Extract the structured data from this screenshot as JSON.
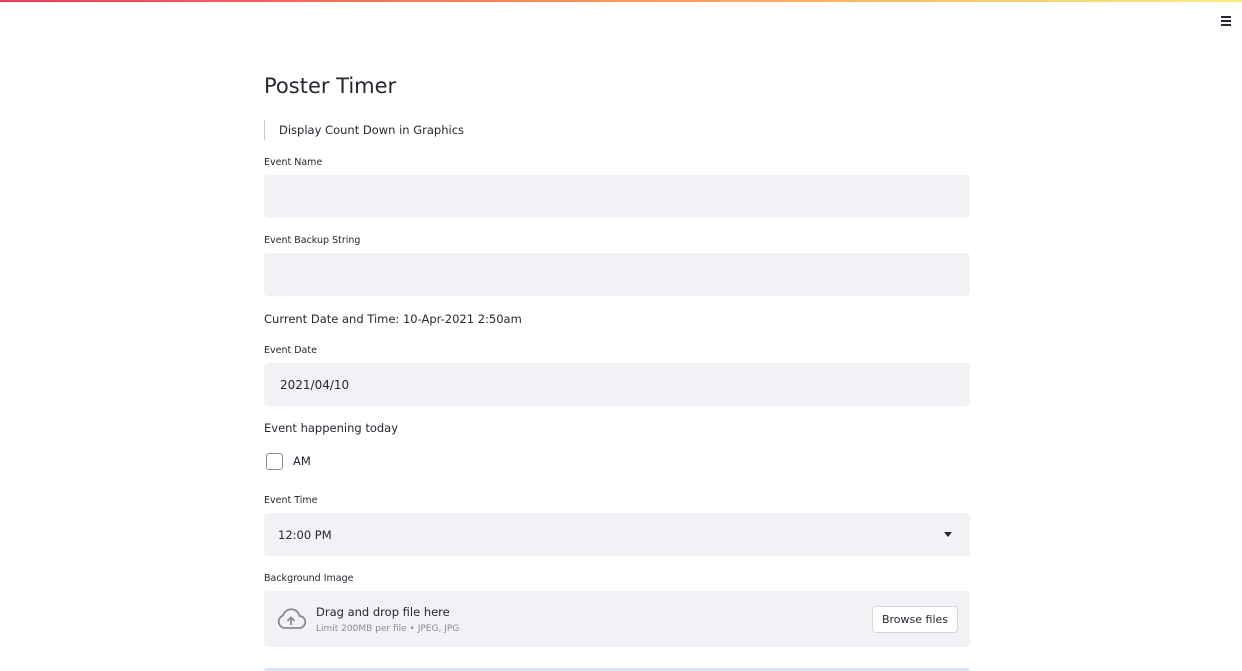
{
  "app": {
    "menu_icon": "hamburger-menu-icon"
  },
  "page": {
    "title": "Poster Timer"
  },
  "display_countdown": {
    "label": "Display Count Down in Graphics"
  },
  "event_name": {
    "label": "Event Name",
    "value": ""
  },
  "event_backup": {
    "label": "Event Backup String",
    "value": ""
  },
  "current_datetime": {
    "text": "Current Date and Time: 10-Apr-2021 2:50am"
  },
  "event_date": {
    "label": "Event Date",
    "value": "2021/04/10"
  },
  "event_today": {
    "text": "Event happening today"
  },
  "am_checkbox": {
    "label": "AM",
    "checked": false
  },
  "event_time": {
    "label": "Event Time",
    "selected": "12:00 PM",
    "icon": "chevron-down-icon"
  },
  "background_image": {
    "label": "Background Image",
    "drop_text": "Drag and drop file here",
    "limit_text": "Limit 200MB per file • JPEG, JPG",
    "browse_label": "Browse files",
    "icon": "cloud-upload-icon"
  },
  "colors": {
    "input_bg": "#f0f2f6",
    "text": "#262730",
    "muted": "#8a8b92",
    "header_gradient": [
      "#d9465c",
      "#ec9a6a",
      "#f7ec90"
    ]
  }
}
